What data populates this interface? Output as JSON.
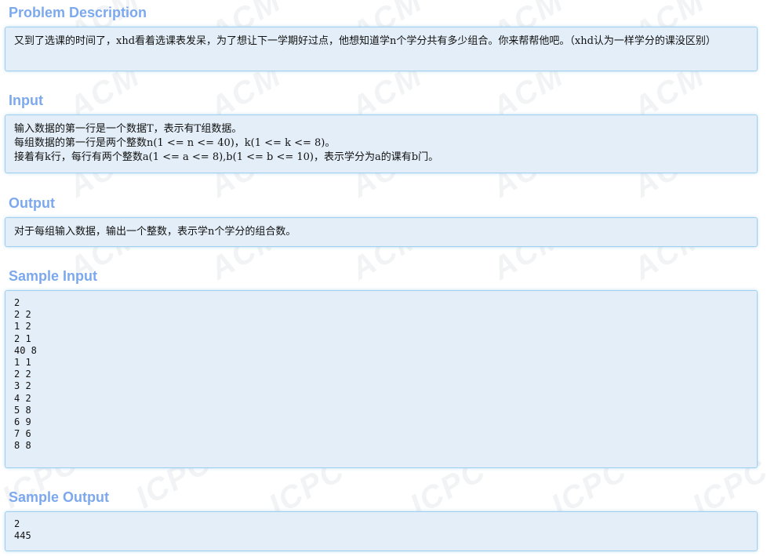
{
  "watermark": {
    "text_a": "ACM",
    "text_b": "ICPC"
  },
  "problem": {
    "title": "Problem Description",
    "body": "又到了选课的时间了，xhd看着选课表发呆，为了想让下一学期好过点，他想知道学n个学分共有多少组合。你来帮帮他吧。（xhd认为一样学分的课没区别）"
  },
  "input": {
    "title": "Input",
    "line1": "输入数据的第一行是一个数据T，表示有T组数据。",
    "line2": "每组数据的第一行是两个整数n(1 <= n <= 40)，k(1 <= k <= 8)。",
    "line3": "接着有k行，每行有两个整数a(1 <= a <= 8),b(1 <= b <= 10)，表示学分为a的课有b门。"
  },
  "output": {
    "title": "Output",
    "body": "对于每组输入数据，输出一个整数，表示学n个学分的组合数。"
  },
  "sample_input": {
    "title": "Sample Input",
    "lines": [
      "2",
      "2 2",
      "1 2",
      "2 1",
      "40 8",
      "1 1",
      "2 2",
      "3 2",
      "4 2",
      "5 8",
      "6 9",
      "7 6",
      "8 8"
    ]
  },
  "sample_output": {
    "title": "Sample Output",
    "lines": [
      "2",
      "445"
    ]
  }
}
